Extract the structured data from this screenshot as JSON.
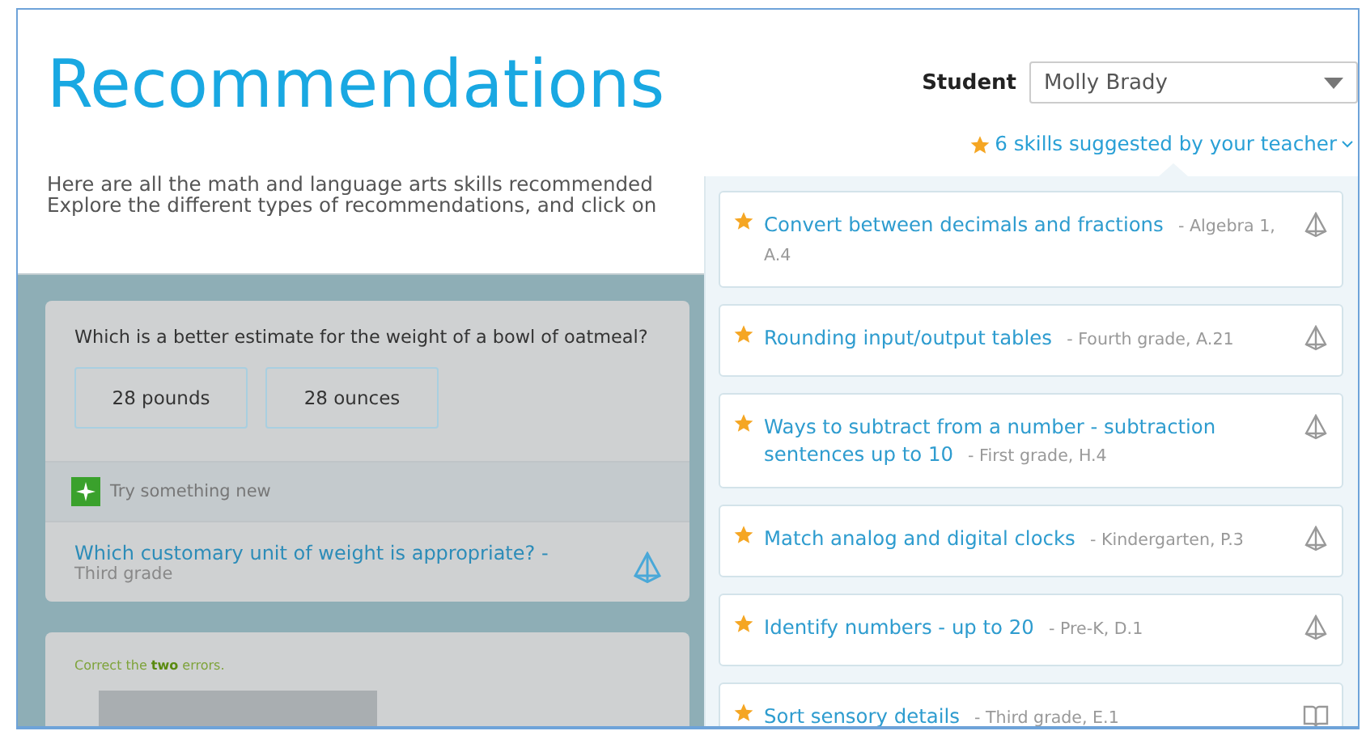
{
  "header": {
    "title": "Recommendations",
    "student_label": "Student",
    "student_select": {
      "value": "Molly Brady"
    },
    "suggested_link": "6 skills suggested by your teacher",
    "intro": [
      "Here are all the math and language arts skills recommended",
      "Explore the different types of recommendations, and click on"
    ]
  },
  "practice_card": {
    "question": "Which is a better estimate for the weight of a bowl of oatmeal?",
    "answers": [
      "28 pounds",
      "28 ounces"
    ],
    "banner": "Try something new",
    "skill_link": "Which customary unit of weight is appropriate? -",
    "skill_grade": "Third grade"
  },
  "second_card": {
    "instruction": "Correct the **two** errors."
  },
  "suggested_skills": [
    {
      "name": "Convert between decimals and fractions",
      "meta": "- Algebra 1, A.4",
      "kind": "math"
    },
    {
      "name": "Rounding input/output tables",
      "meta": "- Fourth grade, A.21",
      "kind": "math"
    },
    {
      "name": "Ways to subtract from a number - subtraction sentences up to 10",
      "meta": "- First grade, H.4",
      "kind": "math"
    },
    {
      "name": "Match analog and digital clocks",
      "meta": "- Kindergarten, P.3",
      "kind": "math"
    },
    {
      "name": "Identify numbers - up to 20",
      "meta": "- Pre-K, D.1",
      "kind": "math"
    },
    {
      "name": "Sort sensory details",
      "meta": "- Third grade, E.1",
      "kind": "language"
    }
  ]
}
